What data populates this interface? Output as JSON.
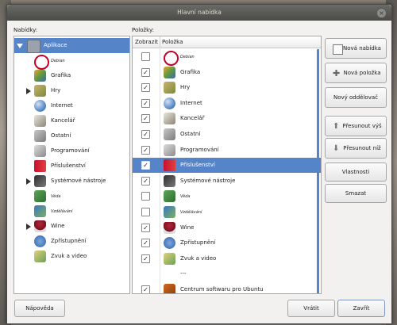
{
  "window": {
    "title": "Hlavní nabídka"
  },
  "left_panel": {
    "label": "Nabídky:",
    "items": [
      {
        "label": "Aplikace",
        "icon": "applications-icon",
        "selected": true,
        "expanded": true,
        "italic": false
      },
      {
        "label": "Debian",
        "icon": "debian-swirl-icon",
        "selected": false,
        "italic": true
      },
      {
        "label": "Grafika",
        "icon": "graphics-icon",
        "selected": false,
        "italic": false
      },
      {
        "label": "Hry",
        "icon": "games-icon",
        "selected": false,
        "italic": false,
        "expander": true
      },
      {
        "label": "Internet",
        "icon": "globe-icon",
        "selected": false,
        "italic": false
      },
      {
        "label": "Kancelář",
        "icon": "office-icon",
        "selected": false,
        "italic": false
      },
      {
        "label": "Ostatní",
        "icon": "other-icon",
        "selected": false,
        "italic": false
      },
      {
        "label": "Programování",
        "icon": "programming-icon",
        "selected": false,
        "italic": false
      },
      {
        "label": "Příslušenství",
        "icon": "accessories-icon",
        "selected": false,
        "italic": false
      },
      {
        "label": "Systémové nástroje",
        "icon": "system-tools-icon",
        "selected": false,
        "italic": false,
        "expander": true
      },
      {
        "label": "Wine",
        "icon": "wine-glass-icon",
        "selected": false,
        "italic": false
      },
      {
        "label": "Zpřístupnění",
        "icon": "accessibility-icon",
        "selected": false,
        "italic": false
      },
      {
        "label": "Zvuk a video",
        "icon": "multimedia-icon",
        "selected": false,
        "italic": false
      }
    ],
    "extra_items": [
      {
        "label": "Věda",
        "icon": "science-icon",
        "italic": true
      },
      {
        "label": "Vzdělávání",
        "icon": "education-icon",
        "italic": true
      },
      {
        "label": "Wine",
        "icon": "wine-glass-icon",
        "italic": false,
        "expander": true
      }
    ]
  },
  "right_panel": {
    "label": "Položky:",
    "col_show": "Zobrazit",
    "col_item": "Položka",
    "rows": [
      {
        "label": "Debian",
        "icon": "debian-swirl-icon",
        "checked": false,
        "italic": true
      },
      {
        "label": "Grafika",
        "icon": "graphics-icon",
        "checked": true,
        "italic": false
      },
      {
        "label": "Hry",
        "icon": "games-icon",
        "checked": true,
        "italic": false
      },
      {
        "label": "Internet",
        "icon": "globe-icon",
        "checked": true,
        "italic": false
      },
      {
        "label": "Kancelář",
        "icon": "office-icon",
        "checked": true,
        "italic": false
      },
      {
        "label": "Ostatní",
        "icon": "other-icon",
        "checked": true,
        "italic": false
      },
      {
        "label": "Programování",
        "icon": "programming-icon",
        "checked": true,
        "italic": false
      },
      {
        "label": "Příslušenství",
        "icon": "accessories-icon",
        "checked": true,
        "italic": false,
        "selected": true
      },
      {
        "label": "Systémové nástroje",
        "icon": "system-tools-icon",
        "checked": true,
        "italic": false
      },
      {
        "label": "Věda",
        "icon": "science-icon",
        "checked": false,
        "italic": true
      },
      {
        "label": "Vzdělávání",
        "icon": "education-icon",
        "checked": false,
        "italic": true
      },
      {
        "label": "Wine",
        "icon": "wine-glass-icon",
        "checked": true,
        "italic": false
      },
      {
        "label": "Zpřístupnění",
        "icon": "accessibility-icon",
        "checked": true,
        "italic": false
      },
      {
        "label": "Zvuk a video",
        "icon": "multimedia-icon",
        "checked": true,
        "italic": false
      },
      {
        "label": "---",
        "icon": "",
        "checked": false,
        "italic": false,
        "separator": true
      },
      {
        "label": "Centrum softwaru pro Ubuntu",
        "icon": "software-center-icon",
        "checked": true,
        "italic": false
      }
    ]
  },
  "buttons": {
    "new_menu": "Nová nabídka",
    "new_item": "Nová položka",
    "new_separator": "Nový oddělovač",
    "move_up": "Přesunout výš",
    "move_down": "Přesunout níž",
    "properties": "Vlastnosti",
    "delete": "Smazat"
  },
  "footer": {
    "help": "Nápověda",
    "revert": "Vrátit",
    "close": "Zavřít"
  },
  "colors": {
    "selection": "#5584c9",
    "titlebar": "#4a4a46"
  }
}
